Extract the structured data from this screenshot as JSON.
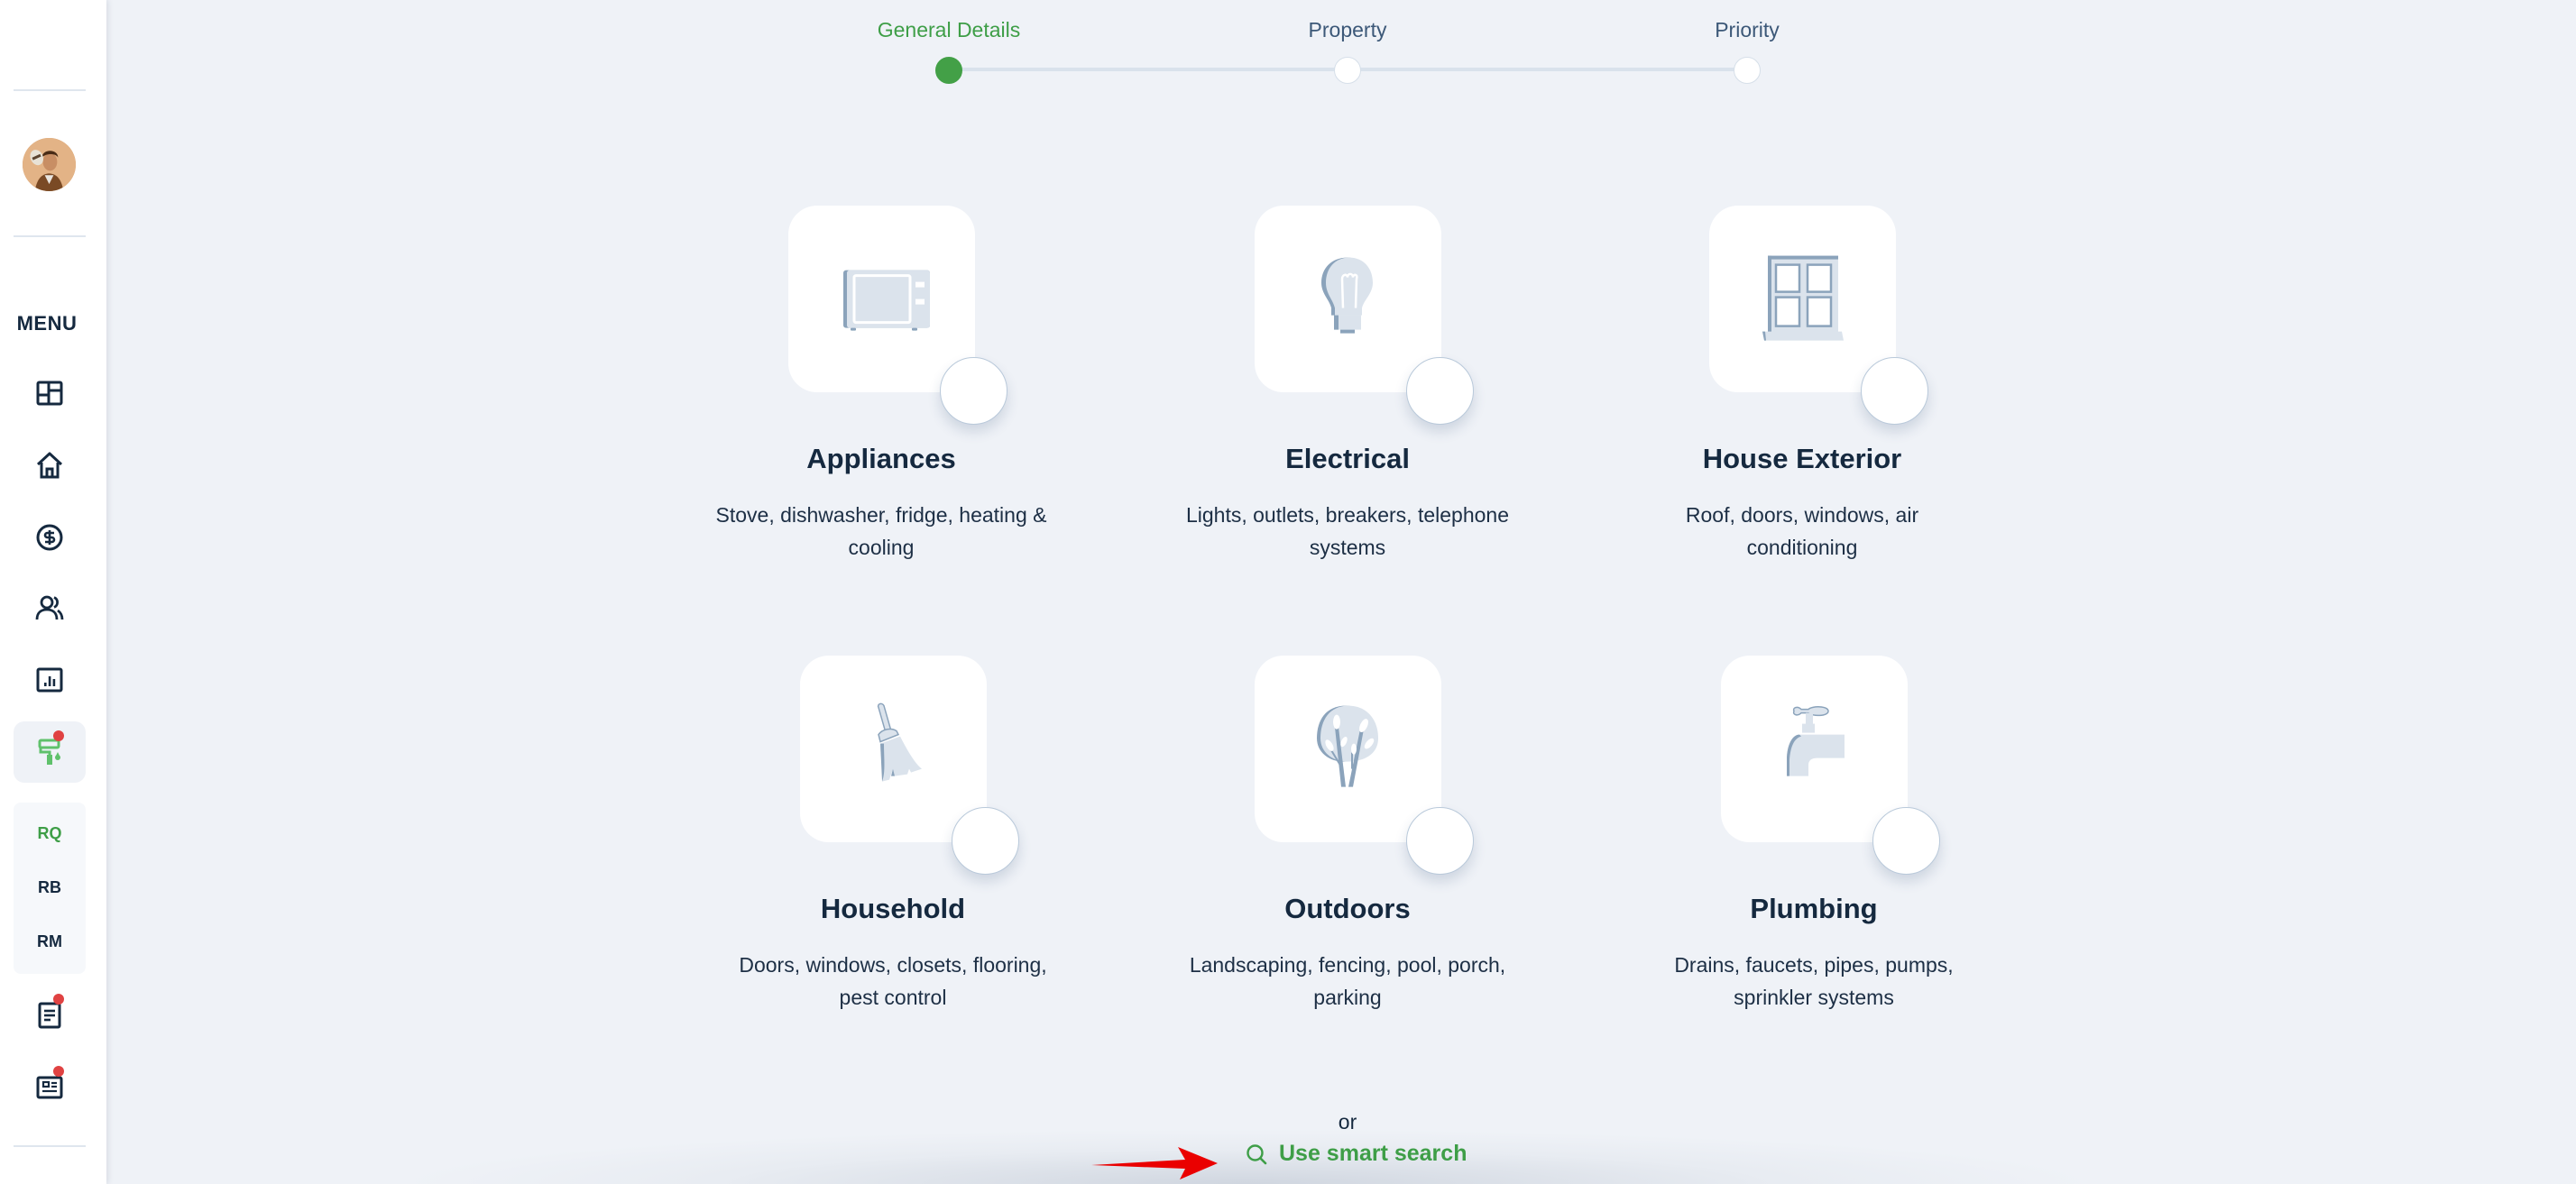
{
  "sidebar": {
    "menu_label": "MENU",
    "avatar_alt": "User avatar",
    "nav_items": [
      {
        "icon": "dashboard-icon",
        "label": "Dashboard"
      },
      {
        "icon": "home-icon",
        "label": "Properties"
      },
      {
        "icon": "dollar-circle-icon",
        "label": "Finance"
      },
      {
        "icon": "users-icon",
        "label": "People"
      },
      {
        "icon": "chart-icon",
        "label": "Reports"
      },
      {
        "icon": "paint-roller-icon",
        "label": "Maintenance",
        "active": true,
        "badge": true
      }
    ],
    "sub_items": [
      {
        "label": "RQ",
        "active": true
      },
      {
        "label": "RB"
      },
      {
        "label": "RM"
      }
    ],
    "bottom_items": [
      {
        "icon": "document-icon",
        "label": "Documents",
        "badge": true
      },
      {
        "icon": "news-icon",
        "label": "Announcements",
        "badge": true
      }
    ]
  },
  "stepper": {
    "steps": [
      {
        "label": "General Details",
        "active": true
      },
      {
        "label": "Property",
        "active": false
      },
      {
        "label": "Priority",
        "active": false
      }
    ]
  },
  "categories": [
    {
      "title": "Appliances",
      "description": "Stove, dishwasher, fridge, heating & cooling",
      "icon": "microwave-icon",
      "selected": false
    },
    {
      "title": "Electrical",
      "description": "Lights, outlets, breakers, telephone systems",
      "icon": "lightbulb-icon",
      "selected": false
    },
    {
      "title": "House Exterior",
      "description": "Roof, doors, windows, air conditioning",
      "icon": "window-icon",
      "selected": false
    },
    {
      "title": "Household",
      "description": "Doors, windows, closets, flooring, pest control",
      "icon": "broom-icon",
      "selected": false
    },
    {
      "title": "Outdoors",
      "description": "Landscaping, fencing, pool, porch, parking",
      "icon": "tree-icon",
      "selected": false
    },
    {
      "title": "Plumbing",
      "description": "Drains, faucets, pipes, pumps, sprinkler systems",
      "icon": "faucet-icon",
      "selected": false
    }
  ],
  "footer": {
    "or_text": "or",
    "smart_search_label": "Use smart search"
  },
  "colors": {
    "accent": "#3e9e47",
    "badge": "#e04242",
    "text_primary": "#15293f",
    "background": "#eff2f7"
  }
}
